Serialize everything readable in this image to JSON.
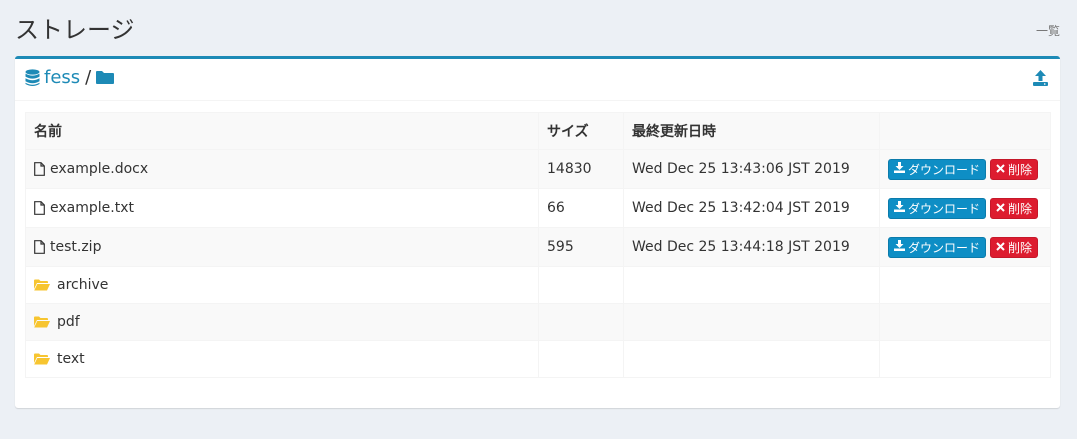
{
  "header": {
    "title": "ストレージ",
    "breadcrumb": "一覧"
  },
  "path": {
    "root": "fess",
    "separator": "/"
  },
  "table": {
    "columns": [
      "名前",
      "サイズ",
      "最終更新日時",
      ""
    ],
    "files": [
      {
        "name": "example.docx",
        "size": "14830",
        "modified": "Wed Dec 25 13:43:06 JST 2019"
      },
      {
        "name": "example.txt",
        "size": "66",
        "modified": "Wed Dec 25 13:42:04 JST 2019"
      },
      {
        "name": "test.zip",
        "size": "595",
        "modified": "Wed Dec 25 13:44:18 JST 2019"
      }
    ],
    "folders": [
      {
        "name": "archive"
      },
      {
        "name": "pdf"
      },
      {
        "name": "text"
      }
    ]
  },
  "actions": {
    "download_label": "ダウンロード",
    "delete_label": "削除"
  },
  "colors": {
    "accent": "#1d8ab6",
    "download": "#0e8ec5",
    "delete": "#dd1c2f",
    "folder": "#f7c530"
  },
  "icons": {
    "root": "database-icon",
    "folder_path": "folder-icon",
    "upload": "upload-icon",
    "file": "file-icon",
    "folder_row": "folder-open-icon",
    "download": "download-icon",
    "delete": "times-icon"
  }
}
